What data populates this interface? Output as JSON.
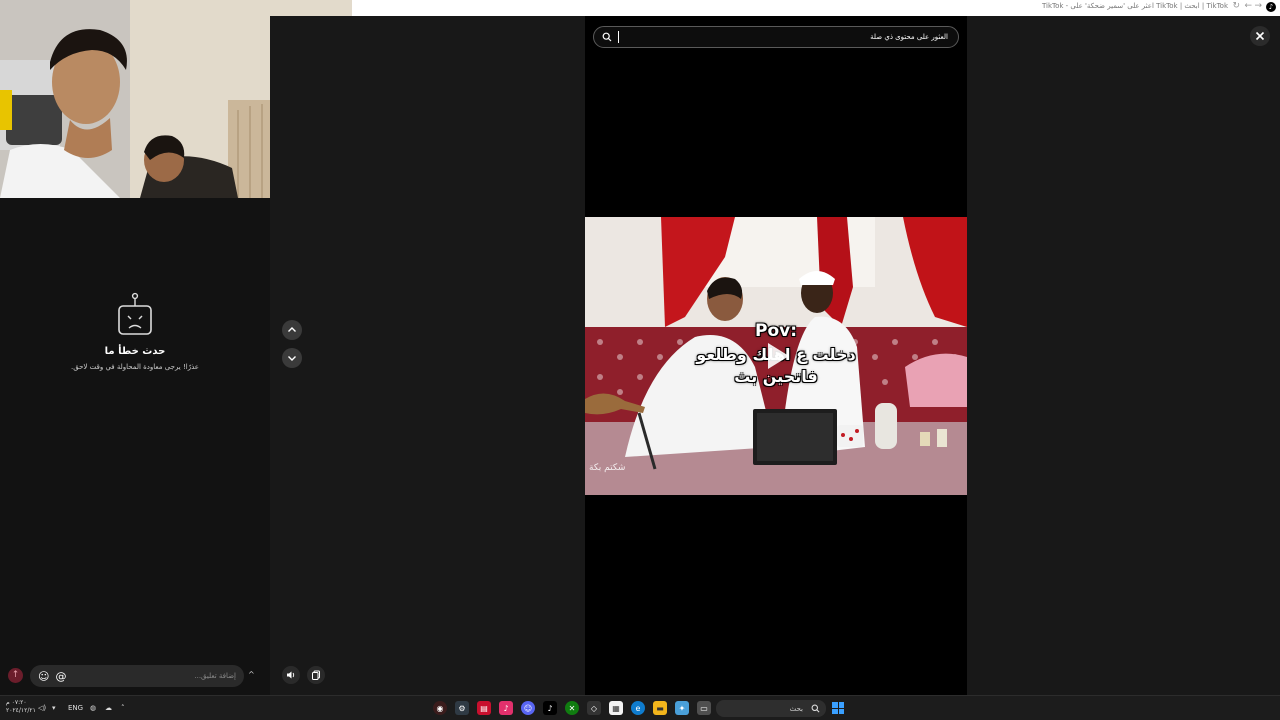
{
  "browser": {
    "tab_title": "TikTok | ابحث | TikTok اعثر على 'سمير ضحكة' على - TikTok",
    "back_glyph": "←",
    "forward_glyph": "→",
    "reload_glyph": "↻"
  },
  "comments_panel": {
    "error_title": "حدث خطأ ما",
    "error_message": "عذرًا! يرجى معاودة المحاولة في وقت لاحق.",
    "comment_placeholder": "إضافة تعليق...",
    "mention_symbol": "@",
    "emoji_symbol": "☺",
    "send_symbol": "↑",
    "expand_symbol": "^"
  },
  "search": {
    "query": "العثور على محتوى ذي صلة"
  },
  "video": {
    "caption_line1": "Pov:",
    "caption_line2": "دخلت ع اهلك وطلعو",
    "caption_line3": "فاتحين بث",
    "watermark": "شكتم بكة"
  },
  "taskbar": {
    "time": "٠٧:٢٠ م",
    "date": "٢٠٢٤/١٢/٢١",
    "language": "ENG",
    "search_placeholder": "بحث"
  },
  "colors": {
    "background": "#121212",
    "side_panels": "#181818",
    "video_bg": "#000000",
    "accent_send": "#6b1d2b"
  },
  "icons": [
    "search-icon",
    "close-icon",
    "robot-error-icon",
    "chevron-up-icon",
    "chevron-down-icon",
    "volume-icon",
    "copy-icon",
    "play-icon"
  ]
}
